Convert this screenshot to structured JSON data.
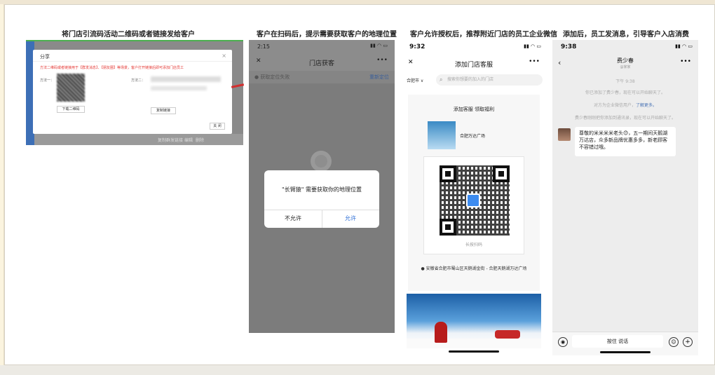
{
  "captions": {
    "step1": "将门店引流码活动二维码或者链接发给客户",
    "step2": "客户在扫码后，提示需要获取客户的地理位置",
    "step3": "客户允许授权后，推荐附近门店的员工企业微信",
    "step4": "添加后，员工发消息，引导客户入店消费"
  },
  "panel1": {
    "dialog_title": "分享",
    "close_glyph": "×",
    "warning": "方法二维码或者链接用于【群发消息】、【朋友圈】等场景，客户打开链接后即可添加门店员工",
    "label_method1": "方法一：",
    "label_method2": "方法二：",
    "download_button": "下载二维码",
    "url_text": "https://",
    "copy_button": "复制链接",
    "close_button": "关 闭",
    "bg_link1": "复制群发链接",
    "bg_link2": "编辑",
    "bg_link3": "删除"
  },
  "panel2": {
    "time": "2:15",
    "signal": "▮▮ ◠ ▭",
    "close_glyph": "✕",
    "title": "门店获客",
    "more_glyph": "•••",
    "location_hint": "● 获取定位失败",
    "relocate": "重新定位",
    "alert_message": "\"长臂猿\" 需要获取你的地理位置",
    "deny_button": "不允许",
    "allow_button": "允许"
  },
  "panel3": {
    "time": "9:32",
    "signal": "▮▮ ◠ ▭",
    "close_glyph": "✕",
    "title": "添加门店客服",
    "more_glyph": "•••",
    "city": "合肥市 ∨",
    "search_icon_glyph": "⌕",
    "search_placeholder": "搜索你想要的加入的门店",
    "card_head": "添加客服 领取福利",
    "store_name": "合肥万达广场",
    "qr_caption": "长按扫码",
    "address": "● 安徽省合肥市蜀山区天鹅湖金街 - 合肥天鹅湖万达广场"
  },
  "panel4": {
    "time": "9:38",
    "signal": "▮▮ ◠ ▭",
    "back_glyph": "‹",
    "contact_name": "费少春",
    "contact_sub": "@家家",
    "more_glyph": "•••",
    "timestamp": "下午 9:38",
    "sys1": "你已添加了费少春，现在可以开始聊天了。",
    "sys2_prefix": "对方为企业微信用户，",
    "sys2_link": "了解更多。",
    "sys3": "费少春刚刚把你添加到通讯录，现在可以开始聊天了。",
    "message": "尊敬的米米米米老头😊，五一期间天鹅湖万达店，众多新品牌优惠多多，新老顾客不容错过哦。",
    "hold_to_talk": "按住 说话",
    "voice_glyph": "◉",
    "emoji_glyph": "☺",
    "plus_glyph": "+"
  },
  "colors": {
    "warning_red": "#e53935",
    "link_blue": "#2f6fd6",
    "sidebar_blue": "#3d6fb6"
  }
}
